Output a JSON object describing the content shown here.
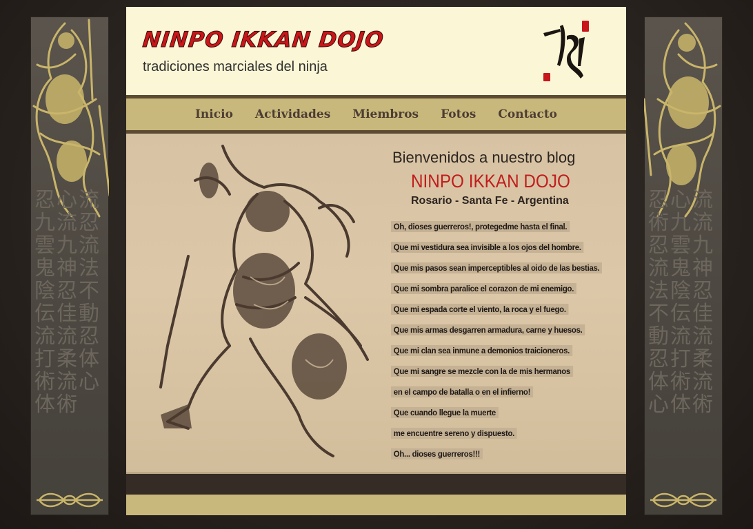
{
  "header": {
    "logo_title": "NINPO IKKAN DOJO",
    "subtitle": "tradiciones marciales del ninja"
  },
  "nav": {
    "items": [
      {
        "label": "Inicio"
      },
      {
        "label": "Actividades"
      },
      {
        "label": "Miembros"
      },
      {
        "label": "Fotos"
      },
      {
        "label": "Contacto"
      }
    ]
  },
  "blog": {
    "heading": "Bienvenidos a nuestro blog",
    "dojo_name": "NINPO IKKAN DOJO",
    "location": "Rosario - Santa Fe - Argentina",
    "prayer_lines": [
      "Oh, dioses guerreros!, protegedme hasta el final.",
      "Que mi vestidura sea invisible a los ojos del hombre.",
      "Que mis pasos sean imperceptibles al oido de las bestias.",
      "Que mi sombra paralice el corazon de mi enemigo.",
      "Que mi espada corte el viento, la roca y el fuego.",
      "Que mis armas desgarren armadura, carne y huesos.",
      "Que mi clan sea inmune a demonios traicioneros.",
      "Que mi sangre se mezcle con la de mis hermanos",
      "en el campo de batalla o en el infierno!",
      "Que cuando llegue la muerte",
      "me encuentre sereno y dispuesto.",
      "Oh... dioses guerreros!!!"
    ]
  },
  "banners": {
    "left_kanji": "忍心流九流忍雲九流鬼神法陰忍不伝佳動流流忍打柔体術流心体術",
    "right_kanji": "忍心流術九流忍雲九流鬼神法陰忍不伝佳動流流忍打柔体術流心体術"
  },
  "colors": {
    "page_bg": "#221d19",
    "header_bg": "#fbf7d6",
    "nav_bg": "#c8b87b",
    "nav_border": "#5c4a33",
    "content_bg": "#d7c3a3",
    "title_red": "#c8161a",
    "gold_art": "#c9b56a"
  },
  "icons": {
    "calligraphy": "brush-calligraphy-icon",
    "vajra": "vajra-ornament-icon",
    "guardian": "guardian-deity-icon"
  }
}
